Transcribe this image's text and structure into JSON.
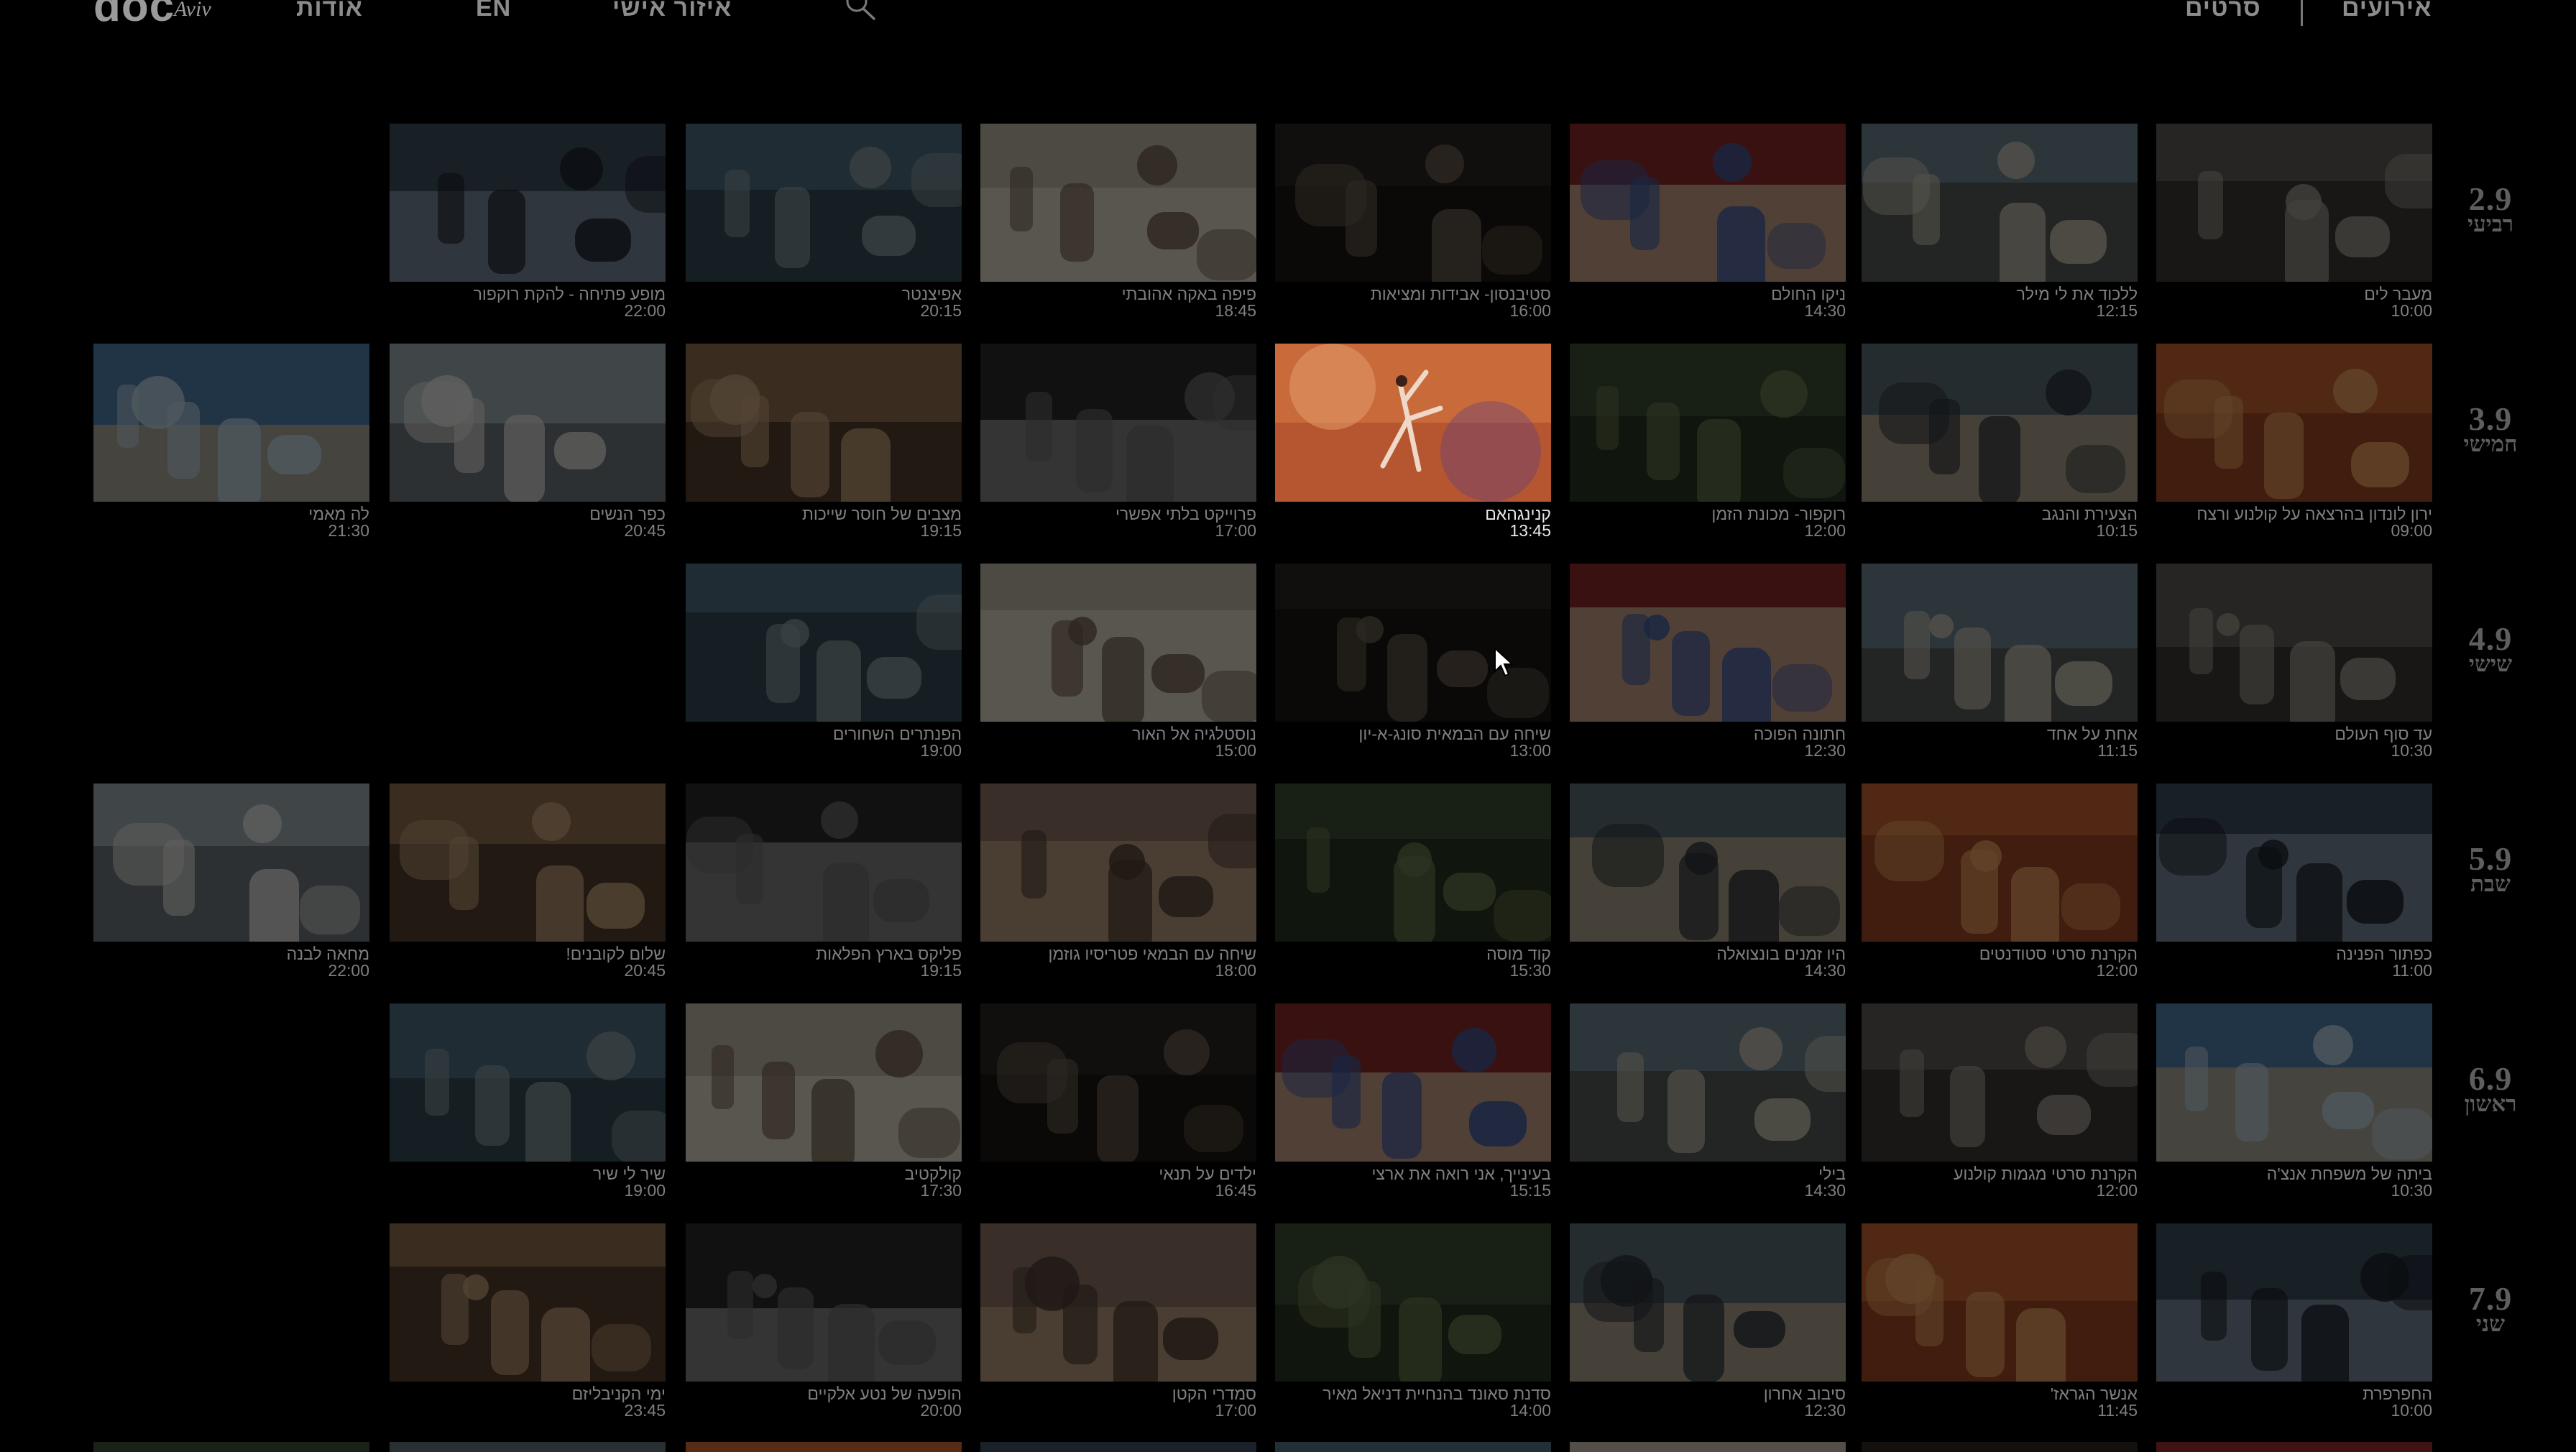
{
  "header": {
    "logo_main": "doc",
    "logo_sub": "Aviv",
    "nav_about": "אודות",
    "nav_en": "EN",
    "nav_personal": "איזור אישי",
    "nav_films": "סרטים",
    "nav_events": "אירועים",
    "search_icon": "search-icon"
  },
  "days": [
    {
      "date": "2.9",
      "name": "רביעי",
      "films": [
        {
          "title": "מעבר לים",
          "time": "10:00"
        },
        {
          "title": "ללכוד את לי מילר",
          "time": "12:15"
        },
        {
          "title": "ניקו החולם",
          "time": "14:30"
        },
        {
          "title": "סטיבנסון- אבידות ומציאות",
          "time": "16:00"
        },
        {
          "title": "פיפה באקה אהובתי",
          "time": "18:45"
        },
        {
          "title": "אפיצנטר",
          "time": "20:15"
        },
        {
          "title": "מופע פתיחה - להקת רוקפור",
          "time": "22:00"
        }
      ]
    },
    {
      "date": "3.9",
      "name": "חמישי",
      "films": [
        {
          "title": "ירון לונדון בהרצאה על קולנוע ורצח",
          "time": "09:00"
        },
        {
          "title": "הצעירת והנגב",
          "time": "10:15"
        },
        {
          "title": "רוקפור- מכונת הזמן",
          "time": "12:00"
        },
        {
          "title": "קנינגהאם",
          "time": "13:45",
          "active": true
        },
        {
          "title": "פרוייקט בלתי אפשרי",
          "time": "17:00"
        },
        {
          "title": "מצבים של חוסר שייכות",
          "time": "19:15"
        },
        {
          "title": "כפר הנשים",
          "time": "20:45"
        },
        {
          "title": "לה מאמי",
          "time": "21:30"
        }
      ]
    },
    {
      "date": "4.9",
      "name": "שישי",
      "films": [
        {
          "title": "עד סוף העולם",
          "time": "10:30"
        },
        {
          "title": "אחת על אחד",
          "time": "11:15"
        },
        {
          "title": "חתונה הפוכה",
          "time": "12:30"
        },
        {
          "title": "שיחה עם הבמאית סונג-א-יון",
          "time": "13:00"
        },
        {
          "title": "נוסטלגיה אל האור",
          "time": "15:00"
        },
        {
          "title": "הפנתרים השחורים",
          "time": "19:00"
        }
      ]
    },
    {
      "date": "5.9",
      "name": "שבת",
      "films": [
        {
          "title": "כפתור הפנינה",
          "time": "11:00"
        },
        {
          "title": "הקרנת סרטי סטודנטים",
          "time": "12:00"
        },
        {
          "title": "היו זמנים בונצואלה",
          "time": "14:30"
        },
        {
          "title": "קוד מוסה",
          "time": "15:30"
        },
        {
          "title": "שיחה עם הבמאי פטריסיו גוזמן",
          "time": "18:00"
        },
        {
          "title": "פליקס בארץ הפלאות",
          "time": "19:15"
        },
        {
          "title": "שלום לקובנים!",
          "time": "20:45"
        },
        {
          "title": "מחאה לבנה",
          "time": "22:00"
        }
      ]
    },
    {
      "date": "6.9",
      "name": "ראשון",
      "films": [
        {
          "title": "ביתה של משפחת אנצ'ה",
          "time": "10:30"
        },
        {
          "title": "הקרנת סרטי מגמות קולנוע",
          "time": "12:00"
        },
        {
          "title": "בילי",
          "time": "14:30"
        },
        {
          "title": "בעינייך, אני רואה את ארצי",
          "time": "15:15"
        },
        {
          "title": "ילדים על תנאי",
          "time": "16:45"
        },
        {
          "title": "קולקטיב",
          "time": "17:30"
        },
        {
          "title": "שיר לי שיר",
          "time": "19:00"
        }
      ]
    },
    {
      "date": "7.9",
      "name": "שני",
      "films": [
        {
          "title": "החפרפרת",
          "time": "10:00"
        },
        {
          "title": "אנשר הגראז'",
          "time": "11:45"
        },
        {
          "title": "סיבוב אחרון",
          "time": "12:30"
        },
        {
          "title": "סדנת סאונד בהנחיית דניאל מאיר",
          "time": "14:00"
        },
        {
          "title": "סמדרי הקטן",
          "time": "17:00"
        },
        {
          "title": "הופעה של נטע אלקיים",
          "time": "20:00"
        },
        {
          "title": "ימי הקניבליזם",
          "time": "23:45"
        }
      ]
    }
  ],
  "colors": {
    "background": "#000000",
    "text_dim": "#7f7f7f",
    "text_active": "#e8e8e8",
    "day_label": "#5e5e5e"
  }
}
